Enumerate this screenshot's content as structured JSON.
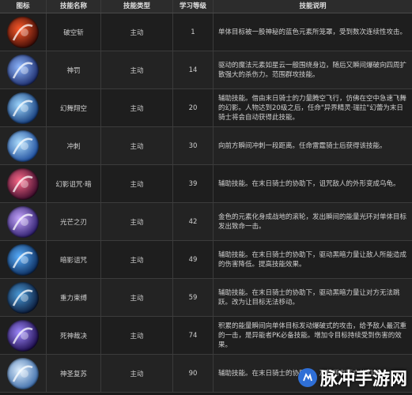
{
  "headers": [
    "图标",
    "技能名称",
    "技能类型",
    "学习等级",
    "技能说明"
  ],
  "rows": [
    {
      "name": "破空斩",
      "type": "主动",
      "level": "1",
      "desc": "单体目标被一股神秘的蓝色元素所笼罩，受到数次连续性攻击。",
      "icon": "broken-sky-slash-icon",
      "color1": "#ff5a2a",
      "color2": "#3a0a05"
    },
    {
      "name": "神罚",
      "type": "主动",
      "level": "14",
      "desc": "驱动的魔法元素如星云一般围绕身边，随后又瞬间爆破向四周扩散强大的杀伤力。范围群攻技能。",
      "icon": "divine-punishment-icon",
      "color1": "#8fb8ff",
      "color2": "#1a2a6a"
    },
    {
      "name": "幻舞翔空",
      "type": "主动",
      "level": "20",
      "desc": "辅助技能。借由末日骑士的力量腾空飞行，仿佛在空中急速飞舞的幻影。人物达到20级之后，任命\"异界精灵·瑞拉\"幻蕾为末日骑士将会自动获得此技能。",
      "icon": "phantom-flight-icon",
      "color1": "#9fd8ff",
      "color2": "#123a7a"
    },
    {
      "name": "冲刺",
      "type": "主动",
      "level": "30",
      "desc": "向前方瞬间冲刺一段距离。任命雷霆骑士后获得该技能。",
      "icon": "dash-icon",
      "color1": "#b0e0ff",
      "color2": "#1a4a9a"
    },
    {
      "name": "幻影诅咒·暗",
      "type": "主动",
      "level": "39",
      "desc": "辅助技能。在末日骑士的协助下，诅咒敌人的外形变成乌龟。",
      "icon": "phantom-curse-icon",
      "color1": "#ff6a8a",
      "color2": "#3a0a2a"
    },
    {
      "name": "光芒之刃",
      "type": "主动",
      "level": "42",
      "desc": "金色的元素化身成战地的滚轮，发出瞬间的能量光环对单体目标发出致命一击。",
      "icon": "light-blade-icon",
      "color1": "#c8a8ff",
      "color2": "#2a1a6a"
    },
    {
      "name": "暗影诅咒",
      "type": "主动",
      "level": "49",
      "desc": "辅助技能。在末日骑士的协助下，驱动黑暗力量让敌人所能造成的伤害降低。提高技能效果。",
      "icon": "shadow-curse-icon",
      "color1": "#5ab0ff",
      "color2": "#0a2a5a"
    },
    {
      "name": "重力束缚",
      "type": "主动",
      "level": "59",
      "desc": "辅助技能。在末日骑士的协助下，驱动黑暗力量让对方无法跳跃。改为让目标无法移动。",
      "icon": "gravity-bind-icon",
      "color1": "#4a9ad8",
      "color2": "#0a1a3a"
    },
    {
      "name": "死神裁决",
      "type": "主动",
      "level": "74",
      "desc": "积累的能量瞬间向单体目标发动爆破式的攻击，给予敌人最沉重的一击，是异能者PK必备技能。增加令目标持续受到伤害的效果。",
      "icon": "death-judgment-icon",
      "color1": "#a08aff",
      "color2": "#1a0a4a"
    },
    {
      "name": "神圣复苏",
      "type": "主动",
      "level": "90",
      "desc": "辅助技能。在末日骑士的协助下，及其所有阵亡的幻兽。",
      "icon": "holy-revival-icon",
      "color1": "#dff0ff",
      "color2": "#3a6aa8"
    }
  ],
  "watermark": {
    "text": "脉冲手游网"
  }
}
